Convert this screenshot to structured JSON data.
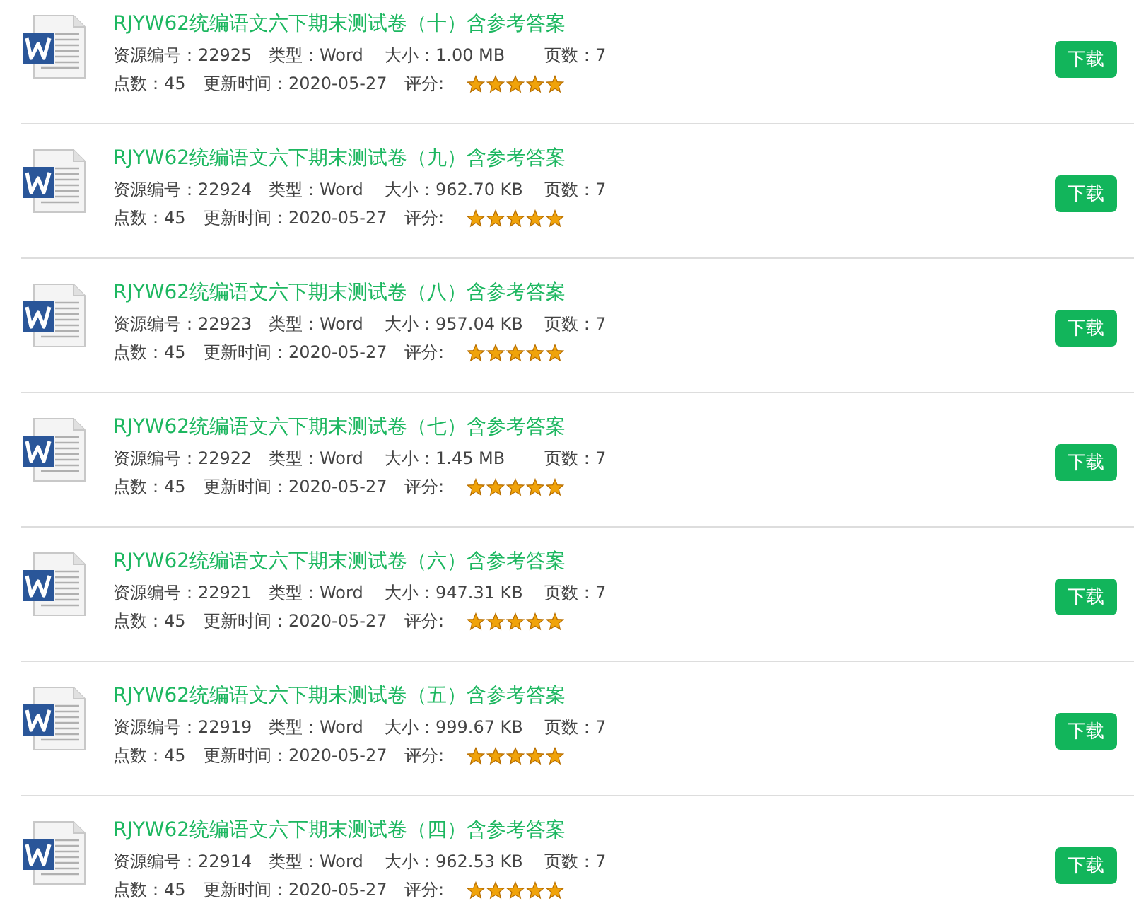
{
  "items": [
    {
      "title": "RJYW62统编语文六下期末测试卷（十）含参考答案",
      "id": "资源编号：22925",
      "type": "类型：Word",
      "size": "大小：1.00 MB",
      "pages": "页数：7",
      "points": "点数：45",
      "updated": "更新时间：2020-05-27",
      "rating_label": "评分:",
      "stars": 5,
      "button": "下载"
    },
    {
      "title": "RJYW62统编语文六下期末测试卷（九）含参考答案",
      "id": "资源编号：22924",
      "type": "类型：Word",
      "size": "大小：962.70 KB",
      "pages": "页数：7",
      "points": "点数：45",
      "updated": "更新时间：2020-05-27",
      "rating_label": "评分:",
      "stars": 5,
      "button": "下载"
    },
    {
      "title": "RJYW62统编语文六下期末测试卷（八）含参考答案",
      "id": "资源编号：22923",
      "type": "类型：Word",
      "size": "大小：957.04 KB",
      "pages": "页数：7",
      "points": "点数：45",
      "updated": "更新时间：2020-05-27",
      "rating_label": "评分:",
      "stars": 5,
      "button": "下载"
    },
    {
      "title": "RJYW62统编语文六下期末测试卷（七）含参考答案",
      "id": "资源编号：22922",
      "type": "类型：Word",
      "size": "大小：1.45 MB",
      "pages": "页数：7",
      "points": "点数：45",
      "updated": "更新时间：2020-05-27",
      "rating_label": "评分:",
      "stars": 5,
      "button": "下载"
    },
    {
      "title": "RJYW62统编语文六下期末测试卷（六）含参考答案",
      "id": "资源编号：22921",
      "type": "类型：Word",
      "size": "大小：947.31 KB",
      "pages": "页数：7",
      "points": "点数：45",
      "updated": "更新时间：2020-05-27",
      "rating_label": "评分:",
      "stars": 5,
      "button": "下载"
    },
    {
      "title": "RJYW62统编语文六下期末测试卷（五）含参考答案",
      "id": "资源编号：22919",
      "type": "类型：Word",
      "size": "大小：999.67 KB",
      "pages": "页数：7",
      "points": "点数：45",
      "updated": "更新时间：2020-05-27",
      "rating_label": "评分:",
      "stars": 5,
      "button": "下载"
    },
    {
      "title": "RJYW62统编语文六下期末测试卷（四）含参考答案",
      "id": "资源编号：22914",
      "type": "类型：Word",
      "size": "大小：962.53 KB",
      "pages": "页数：7",
      "points": "点数：45",
      "updated": "更新时间：2020-05-27",
      "rating_label": "评分:",
      "stars": 5,
      "button": "下载"
    }
  ]
}
